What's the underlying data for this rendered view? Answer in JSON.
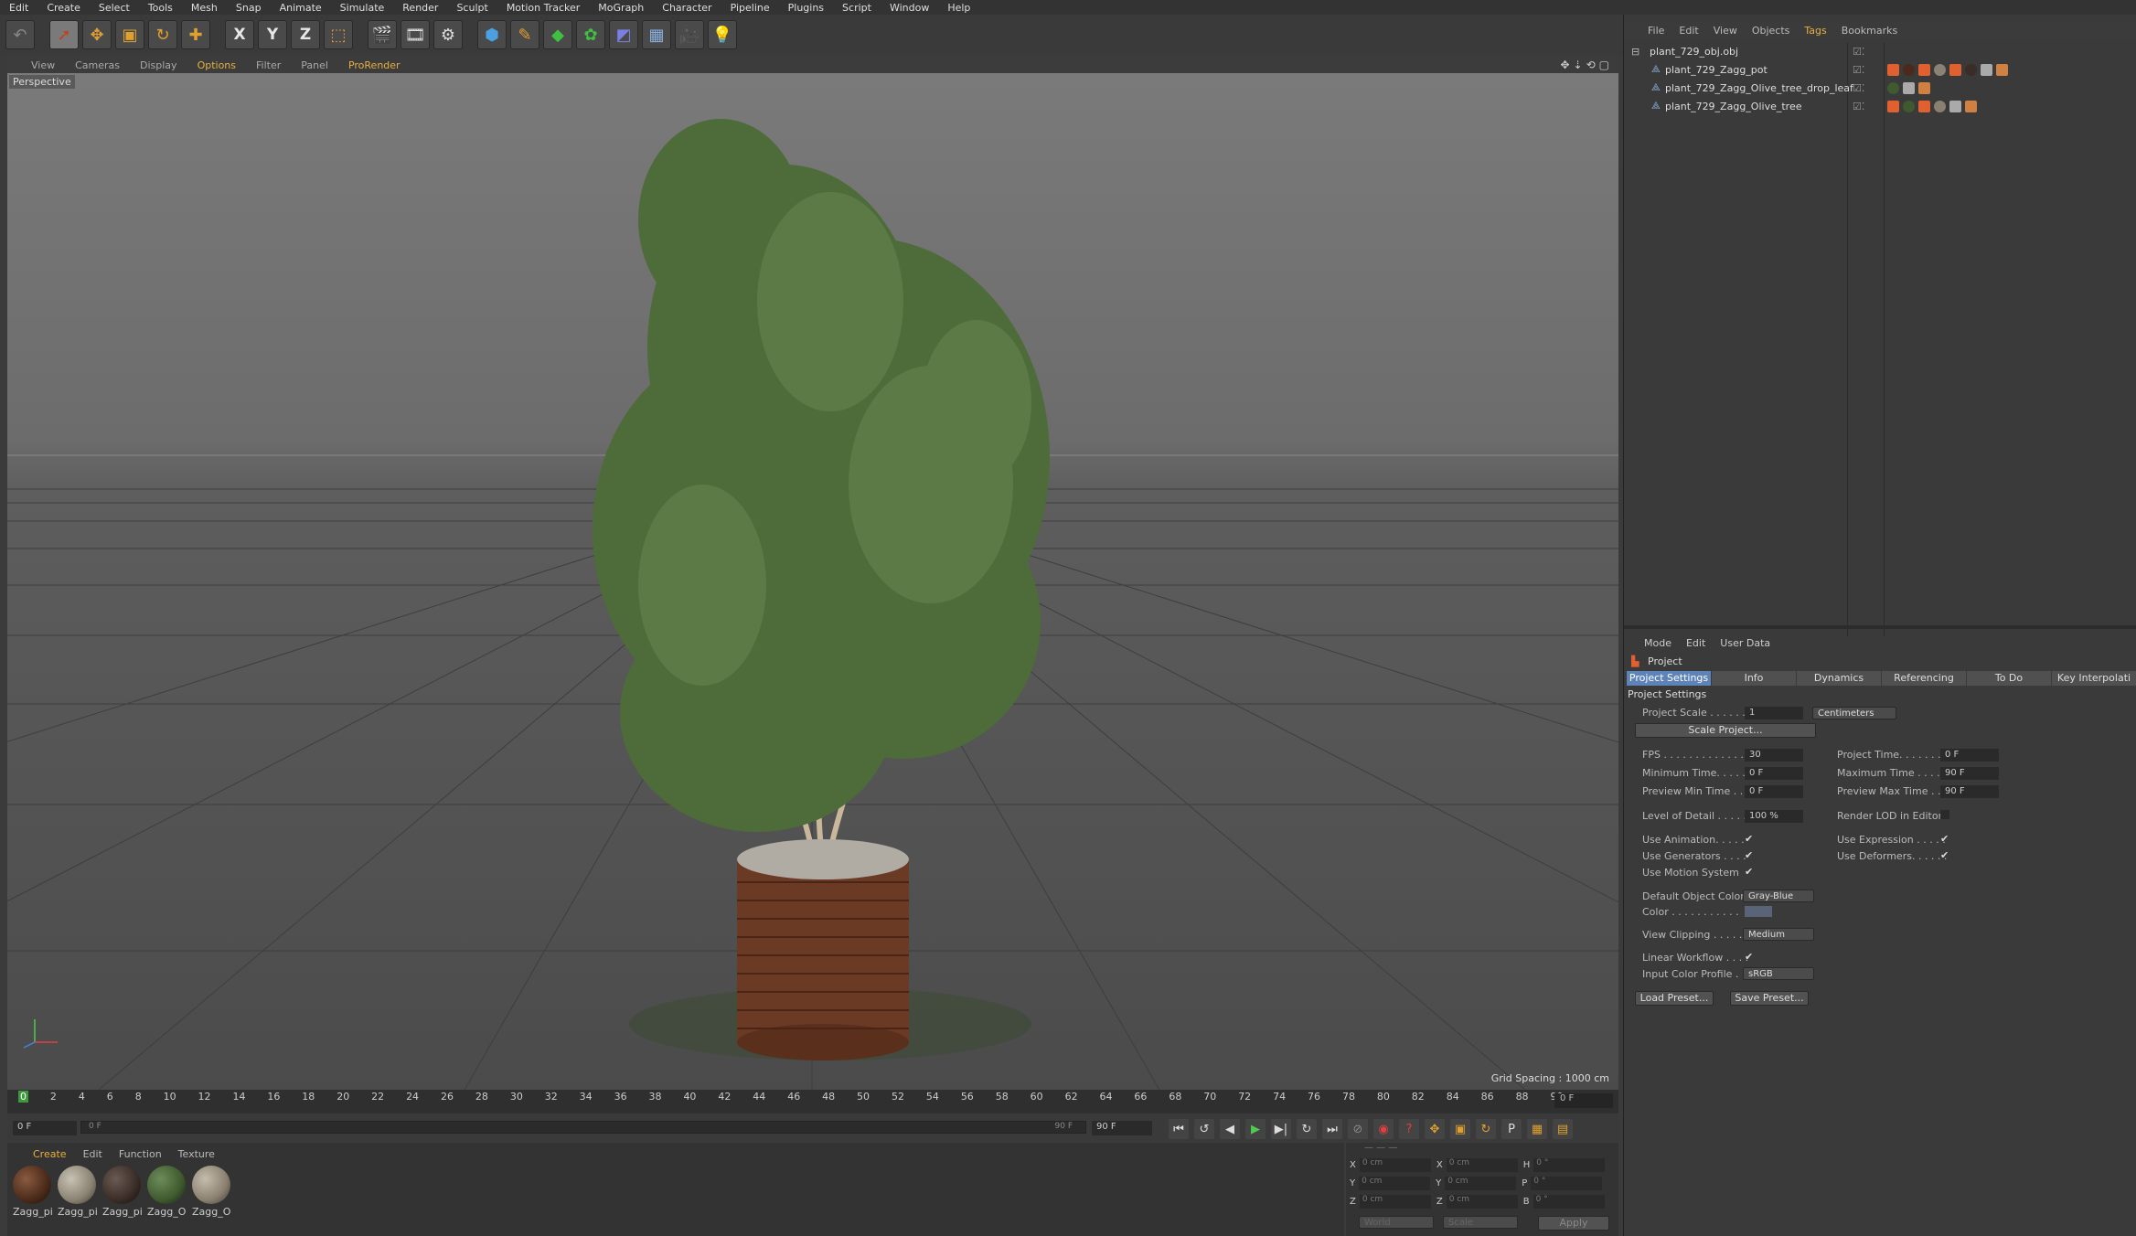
{
  "menu": [
    "Edit",
    "Create",
    "Select",
    "Tools",
    "Mesh",
    "Snap",
    "Animate",
    "Simulate",
    "Render",
    "Sculpt",
    "Motion Tracker",
    "MoGraph",
    "Character",
    "Pipeline",
    "Plugins",
    "Script",
    "Window",
    "Help"
  ],
  "toolbar": {
    "axis": [
      "X",
      "Y",
      "Z"
    ]
  },
  "viewport": {
    "menu": [
      "View",
      "Cameras",
      "Display",
      "Options",
      "Filter",
      "Panel",
      "ProRender"
    ],
    "label": "Perspective",
    "grid": "Grid Spacing : 1000 cm"
  },
  "timeline": {
    "ticks": [
      "0",
      "2",
      "4",
      "6",
      "8",
      "10",
      "12",
      "14",
      "16",
      "18",
      "20",
      "22",
      "24",
      "26",
      "28",
      "30",
      "32",
      "34",
      "36",
      "38",
      "40",
      "42",
      "44",
      "46",
      "48",
      "50",
      "52",
      "54",
      "56",
      "58",
      "60",
      "62",
      "64",
      "66",
      "68",
      "70",
      "72",
      "74",
      "76",
      "78",
      "80",
      "82",
      "84",
      "86",
      "88",
      "90"
    ],
    "current": "0 F",
    "start": "0 F",
    "slider_left": "0 F",
    "slider_right": "90 F",
    "end": "90 F"
  },
  "materials": {
    "menu": [
      "Create",
      "Edit",
      "Function",
      "Texture"
    ],
    "items": [
      {
        "name": "Zagg_pi",
        "color": "#4a2a1a"
      },
      {
        "name": "Zagg_pi",
        "color": "#8a8272"
      },
      {
        "name": "Zagg_pi",
        "color": "#3a2c26"
      },
      {
        "name": "Zagg_O",
        "color": "#3e5a2e"
      },
      {
        "name": "Zagg_O",
        "color": "#8a8070"
      }
    ]
  },
  "coords": {
    "rows": [
      [
        "X",
        "0 cm",
        "X",
        "0 cm",
        "H",
        "0 °"
      ],
      [
        "Y",
        "0 cm",
        "Y",
        "0 cm",
        "P",
        "0 °"
      ],
      [
        "Z",
        "0 cm",
        "Z",
        "0 cm",
        "B",
        "0 °"
      ]
    ],
    "world": "World",
    "scale": "Scale",
    "apply": "Apply"
  },
  "objects": {
    "menu": [
      "File",
      "Edit",
      "View",
      "Objects",
      "Tags",
      "Bookmarks"
    ],
    "root": "plant_729_obj.obj",
    "children": [
      "plant_729_Zagg_pot",
      "plant_729_Zagg_Olive_tree_drop_leaf",
      "plant_729_Zagg_Olive_tree"
    ]
  },
  "attributes": {
    "menu": [
      "Mode",
      "Edit",
      "User Data"
    ],
    "object": "Project",
    "tabs": [
      "Project Settings",
      "Info",
      "Dynamics",
      "Referencing",
      "To Do",
      "Key Interpolati"
    ],
    "section": "Project Settings",
    "project_scale": {
      "label": "Project Scale . . . . . .",
      "value": "1",
      "unit": "Centimeters"
    },
    "scale_btn": "Scale Project...",
    "fps": {
      "label": "FPS . . . . . . . . . . . . . .",
      "value": "30"
    },
    "project_time": {
      "label": "Project Time. . . . . . .",
      "value": "0 F"
    },
    "min_time": {
      "label": "Minimum Time. . . . . . .",
      "value": "0 F"
    },
    "max_time": {
      "label": "Maximum Time . . . . .",
      "value": "90 F"
    },
    "pmin_time": {
      "label": "Preview Min Time . . .",
      "value": "0 F"
    },
    "pmax_time": {
      "label": "Preview Max Time . . .",
      "value": "90 F"
    },
    "lod": {
      "label": "Level of Detail . . . . .",
      "value": "100 %"
    },
    "render_lod": "Render LOD in Editor",
    "use_anim": "Use Animation. . . . .",
    "use_expr": "Use Expression . . . . .",
    "use_gen": "Use Generators . . . .",
    "use_def": "Use Deformers. . . . . .",
    "use_motion": "Use Motion System",
    "def_color": {
      "label": "Default Object Color",
      "value": "Gray-Blue"
    },
    "color": "Color . . . . . . . . . . .",
    "clipping": {
      "label": "View Clipping . . . . . .",
      "value": "Medium"
    },
    "linear": "Linear Workflow . . . .",
    "profile": {
      "label": "Input Color Profile . .",
      "value": "sRGB"
    },
    "load": "Load Preset...",
    "save": "Save Preset..."
  }
}
